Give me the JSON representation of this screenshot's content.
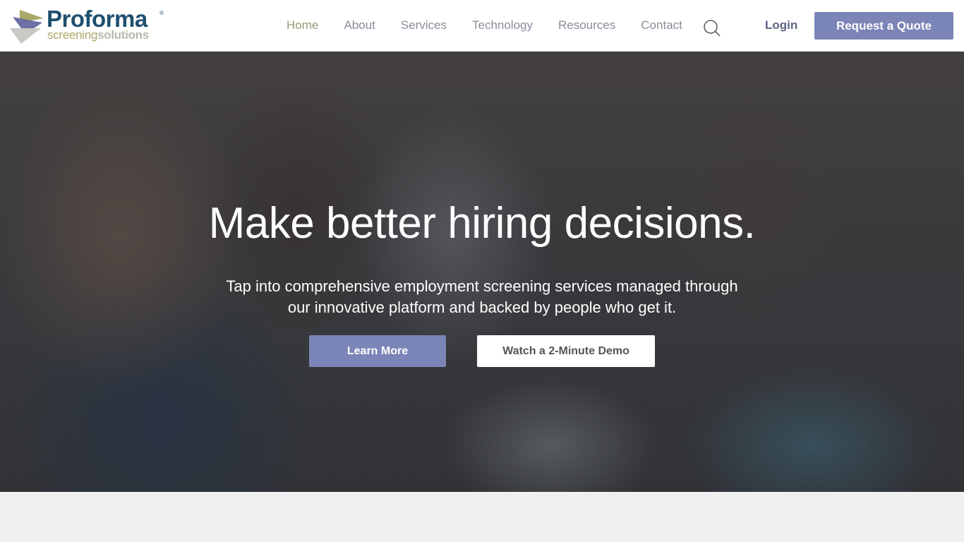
{
  "brand": {
    "name": "Proforma",
    "sub_light": "screening",
    "sub_bold": "solutions",
    "registered": "®"
  },
  "nav": {
    "items": [
      {
        "label": "Home",
        "active": true
      },
      {
        "label": "About",
        "active": false
      },
      {
        "label": "Services",
        "active": false
      },
      {
        "label": "Technology",
        "active": false
      },
      {
        "label": "Resources",
        "active": false
      },
      {
        "label": "Contact",
        "active": false
      }
    ],
    "search_icon": "search-icon",
    "login_label": "Login",
    "quote_label": "Request a Quote"
  },
  "hero": {
    "title": "Make better hiring decisions.",
    "subtitle_line1": "Tap into comprehensive employment screening services managed through",
    "subtitle_line2": "our innovative platform and backed by people who get it.",
    "primary_cta": "Learn More",
    "secondary_cta": "Watch a 2-Minute Demo"
  },
  "colors": {
    "accent": "#7c85b8",
    "brand_blue": "#1f4f6f",
    "brand_olive": "#a9a96a",
    "nav_text": "#888d99",
    "section_bg": "#f0f0f0"
  }
}
